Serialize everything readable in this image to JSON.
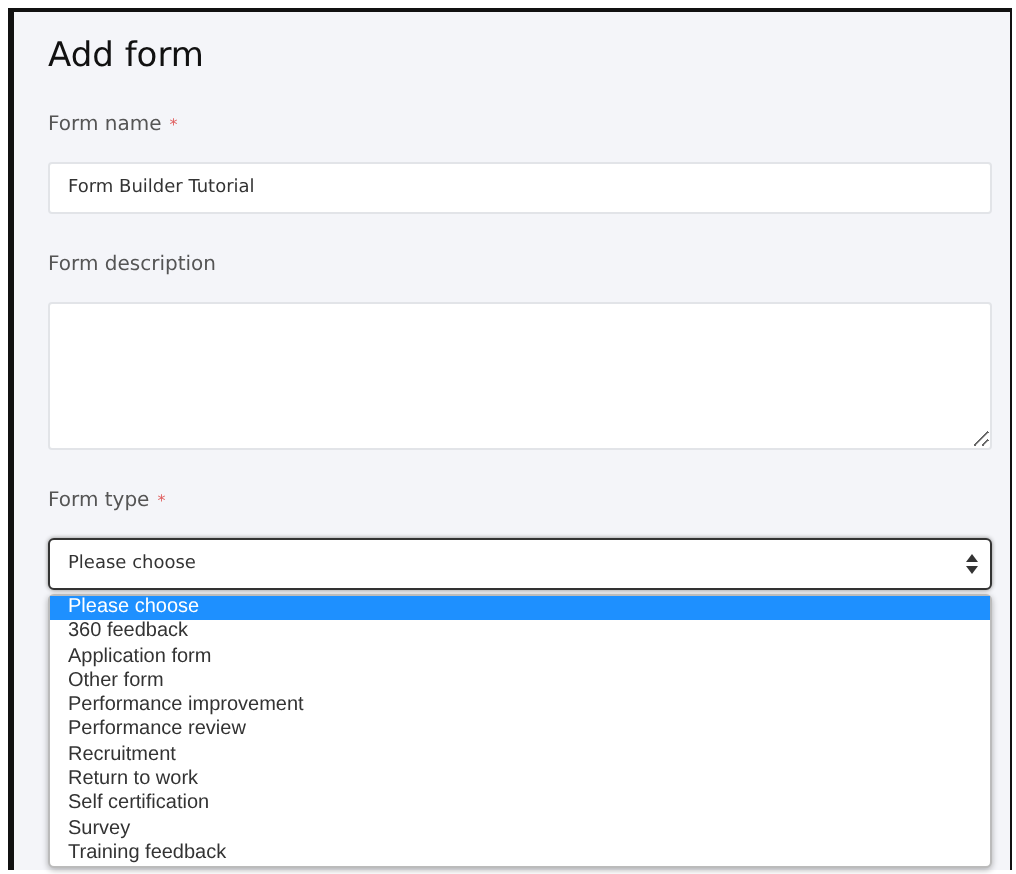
{
  "title": "Add form",
  "fields": [
    {
      "kind": "text",
      "label": "Form name",
      "required_mark": "*",
      "value": "Form Builder Tutorial"
    },
    {
      "kind": "textarea",
      "label": "Form description"
    },
    {
      "kind": "select",
      "label": "Form type",
      "required_mark": "*",
      "value": "Please choose",
      "expanded": true,
      "options": [
        {
          "label": "Please choose",
          "selected": true
        },
        {
          "label": "360 feedback",
          "selected": false
        },
        {
          "label": "Application form",
          "selected": false
        },
        {
          "label": "Other form",
          "selected": false
        },
        {
          "label": "Performance improvement",
          "selected": false
        },
        {
          "label": "Performance review",
          "selected": false
        },
        {
          "label": "Recruitment",
          "selected": false
        },
        {
          "label": "Return to work",
          "selected": false
        },
        {
          "label": "Self certification",
          "selected": false
        },
        {
          "label": "Survey",
          "selected": false
        },
        {
          "label": "Training feedback",
          "selected": false
        }
      ]
    }
  ]
}
